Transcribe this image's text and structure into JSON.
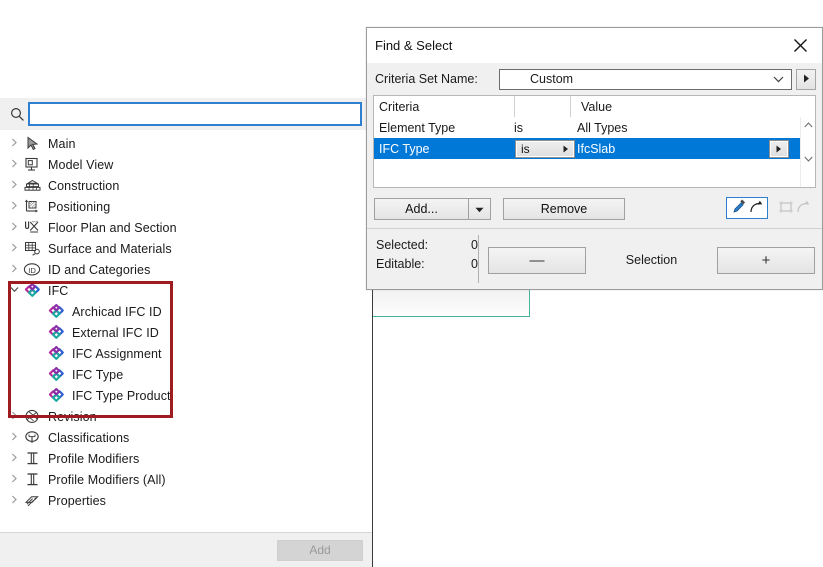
{
  "picker": {
    "search": {
      "value": "",
      "placeholder": ""
    },
    "search_icon": "search-icon",
    "add_label": "Add",
    "tree": [
      {
        "label": "Main",
        "icon": "arrow-cursor-icon",
        "level": 0,
        "expanded": false
      },
      {
        "label": "Model View",
        "icon": "monitor-icon",
        "level": 0,
        "expanded": false
      },
      {
        "label": "Construction",
        "icon": "layers-icon",
        "level": 0,
        "expanded": false
      },
      {
        "label": "Positioning",
        "icon": "positioning-icon",
        "level": 0,
        "expanded": false
      },
      {
        "label": "Floor Plan and Section",
        "icon": "floorplan-icon",
        "level": 0,
        "expanded": false
      },
      {
        "label": "Surface and Materials",
        "icon": "surface-icon",
        "level": 0,
        "expanded": false
      },
      {
        "label": "ID and Categories",
        "icon": "id-circle-icon",
        "level": 0,
        "expanded": false
      },
      {
        "label": "IFC",
        "icon": "ifc-knot-icon",
        "level": 0,
        "expanded": true
      },
      {
        "label": "Archicad IFC ID",
        "icon": "ifc-knot-icon",
        "level": 1,
        "expanded": false
      },
      {
        "label": "External IFC ID",
        "icon": "ifc-knot-icon",
        "level": 1,
        "expanded": false
      },
      {
        "label": "IFC Assignment",
        "icon": "ifc-knot-icon",
        "level": 1,
        "expanded": false
      },
      {
        "label": "IFC Type",
        "icon": "ifc-knot-icon",
        "level": 1,
        "expanded": false
      },
      {
        "label": "IFC Type Product",
        "icon": "ifc-knot-icon",
        "level": 1,
        "expanded": false
      },
      {
        "label": "Revision",
        "icon": "revision-icon",
        "level": 0,
        "expanded": false
      },
      {
        "label": "Classifications",
        "icon": "classification-tree-icon",
        "level": 0,
        "expanded": false
      },
      {
        "label": "Profile Modifiers",
        "icon": "i-beam-icon",
        "level": 0,
        "expanded": false
      },
      {
        "label": "Profile Modifiers (All)",
        "icon": "i-beam-icon",
        "level": 0,
        "expanded": false
      },
      {
        "label": "Properties",
        "icon": "properties-tag-icon",
        "level": 0,
        "expanded": false
      }
    ]
  },
  "annotation": {
    "color": "#9e1b20",
    "name": "ifc-group-highlight"
  },
  "dialog": {
    "title": "Find & Select",
    "close_icon": "close-icon",
    "criteria_set_label": "Criteria Set Name:",
    "criteria_set_value": "Custom",
    "criteria_set_expand_icon": "play-triangle-icon",
    "table": {
      "headers": [
        "Criteria",
        "",
        "Value"
      ],
      "rows": [
        {
          "criteria": "Element Type",
          "operator": "is",
          "value": "All Types",
          "selected": false,
          "editable": false
        },
        {
          "criteria": "IFC Type",
          "operator": "is",
          "value": "IfcSlab",
          "selected": true,
          "editable": true
        }
      ],
      "scroll_up_icon": "chevron-up-icon",
      "scroll_down_icon": "chevron-down-icon"
    },
    "buttons": {
      "add_label": "Add...",
      "add_dropdown_icon": "chevron-down-icon",
      "remove_label": "Remove"
    },
    "tools": [
      {
        "name": "pick-up-parameters-button",
        "icon": "eyedropper-icon",
        "active": true,
        "enabled": true
      },
      {
        "name": "inject-parameters-button",
        "icon": "selection-rect-icon",
        "active": false,
        "enabled": false
      }
    ],
    "status": {
      "selected_label": "Selected:",
      "selected_value": "0",
      "editable_label": "Editable:",
      "editable_value": "0",
      "selection_label": "Selection",
      "minus_label": "—",
      "plus_label": "+"
    },
    "accent_color": "#0078d7"
  }
}
